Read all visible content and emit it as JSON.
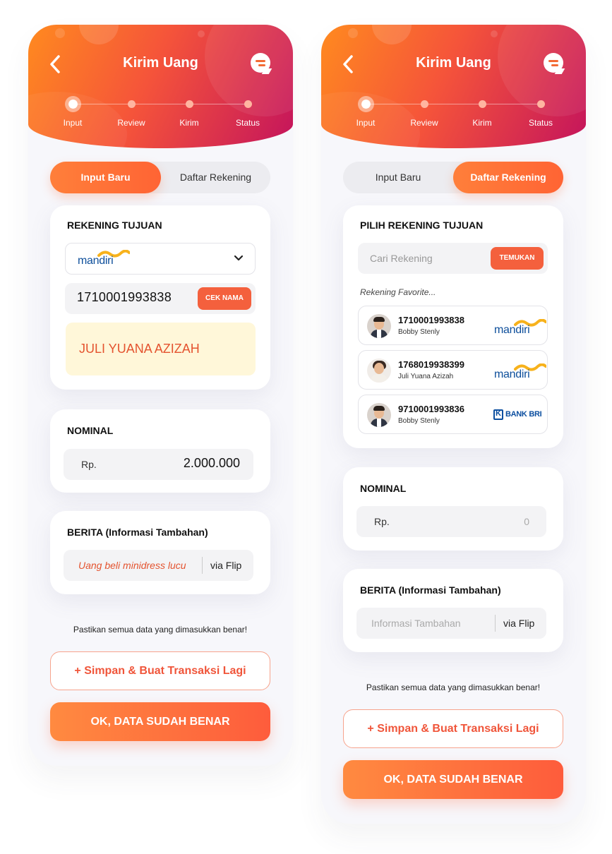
{
  "common": {
    "title": "Kirim Uang",
    "steps": [
      "Input",
      "Review",
      "Kirim",
      "Status"
    ],
    "tabs": {
      "new": "Input Baru",
      "list": "Daftar Rekening"
    },
    "nominal_title": "NOMINAL",
    "currency": "Rp.",
    "berita_title": "BERITA (Informasi Tambahan)",
    "via": "via Flip",
    "confirm_text": "Pastikan semua data yang dimasukkan benar!",
    "save_more_label": "+ Simpan & Buat Transaksi Lagi",
    "ok_label": "OK, DATA SUDAH BENAR",
    "bank_mandiri": "mandiri",
    "bank_bri": "BANK BRI"
  },
  "left": {
    "card_title": "REKENING TUJUAN",
    "account_number": "1710001993838",
    "cek_nama": "CEK NAMA",
    "account_name": "JULI YUANA AZIZAH",
    "amount": "2.000.000",
    "note": "Uang beli minidress lucu"
  },
  "right": {
    "card_title": "PILIH REKENING TUJUAN",
    "search_placeholder": "Cari Rekening",
    "search_button": "TEMUKAN",
    "favorite_label": "Rekening Favorite...",
    "favorites": [
      {
        "number": "1710001993838",
        "name": "Bobby Stenly",
        "bank": "mandiri"
      },
      {
        "number": "1768019938399",
        "name": "Juli Yuana Azizah",
        "bank": "mandiri"
      },
      {
        "number": "9710001993836",
        "name": "Bobby Stenly",
        "bank": "BANK BRI"
      }
    ],
    "amount": "0",
    "note_placeholder": "Informasi Tambahan"
  }
}
